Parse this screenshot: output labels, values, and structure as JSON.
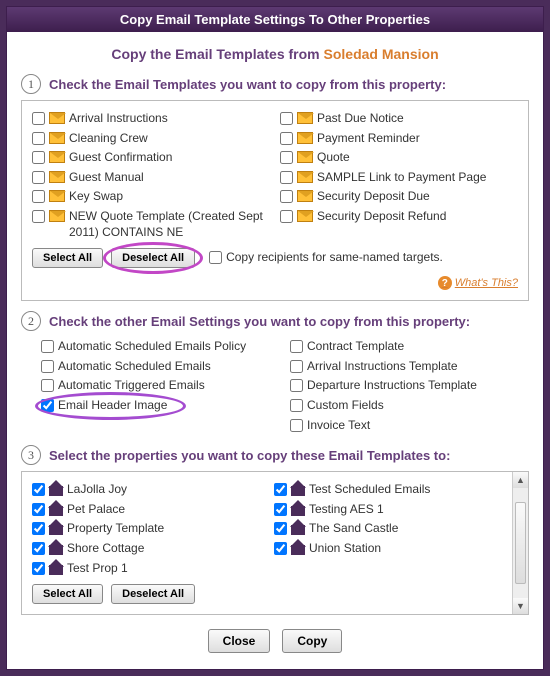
{
  "title": "Copy Email Template Settings To Other Properties",
  "subtitle_prefix": "Copy the Email Templates from ",
  "source_property": "Soledad Mansion",
  "step1": {
    "label": "Check the Email Templates you want to copy from this property:",
    "left": [
      "Arrival Instructions",
      "Cleaning Crew",
      "Guest Confirmation",
      "Guest Manual",
      "Key Swap",
      "NEW Quote Template (Created Sept 2011) CONTAINS NE"
    ],
    "right": [
      "Past Due Notice",
      "Payment Reminder",
      "Quote",
      "SAMPLE Link to Payment Page",
      "Security Deposit Due",
      "Security Deposit Refund"
    ],
    "select_all": "Select All",
    "deselect_all": "Deselect All",
    "copy_recipients": "Copy recipients for same-named targets.",
    "whats_this": "What's This?"
  },
  "step2": {
    "label": "Check the other Email Settings you want to copy from this property:",
    "left": [
      {
        "label": "Automatic Scheduled Emails Policy",
        "checked": false
      },
      {
        "label": "Automatic Scheduled Emails",
        "checked": false
      },
      {
        "label": "Automatic Triggered Emails",
        "checked": false
      },
      {
        "label": "Email Header Image",
        "checked": true
      }
    ],
    "right": [
      {
        "label": "Contract Template",
        "checked": false
      },
      {
        "label": "Arrival Instructions Template",
        "checked": false
      },
      {
        "label": "Departure Instructions Template",
        "checked": false
      },
      {
        "label": "Custom Fields",
        "checked": false
      },
      {
        "label": "Invoice Text",
        "checked": false
      }
    ]
  },
  "step3": {
    "label": "Select the properties you want to copy these Email Templates to:",
    "left": [
      "LaJolla Joy",
      "Pet Palace",
      "Property Template",
      "Shore Cottage",
      "Test Prop 1"
    ],
    "right": [
      "Test Scheduled Emails",
      "Testing AES 1",
      "The Sand Castle",
      "Union Station"
    ],
    "select_all": "Select All",
    "deselect_all": "Deselect All"
  },
  "buttons": {
    "close": "Close",
    "copy": "Copy"
  },
  "nums": {
    "one": "1",
    "two": "2",
    "three": "3"
  }
}
